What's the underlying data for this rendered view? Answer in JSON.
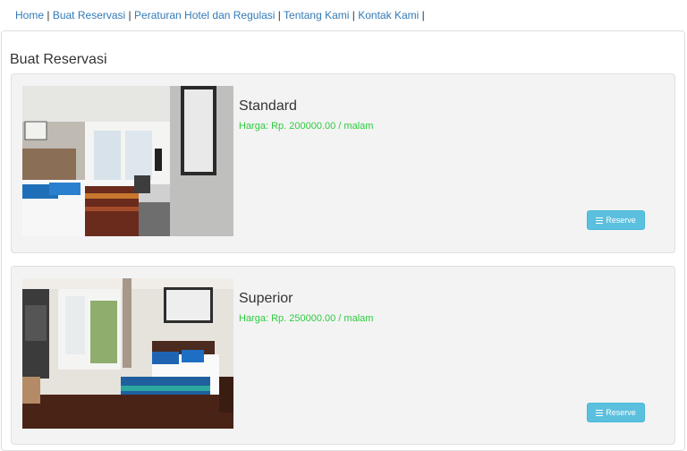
{
  "nav": {
    "items": [
      "Home",
      "Buat Reservasi",
      "Peraturan Hotel dan Regulasi",
      "Tentang Kami",
      "Kontak Kami"
    ],
    "separator": "|"
  },
  "page": {
    "title": "Buat Reservasi"
  },
  "rooms": [
    {
      "name": "Standard",
      "price": "Harga: Rp. 200000.00 / malam",
      "button_label": "Reserve"
    },
    {
      "name": "Superior",
      "price": "Harga: Rp. 250000.00 / malam",
      "button_label": "Reserve"
    }
  ],
  "colors": {
    "link": "#337ab7",
    "price": "#2ecc40",
    "button": "#5bc0de"
  },
  "icons": {
    "reserve": "list-icon"
  }
}
